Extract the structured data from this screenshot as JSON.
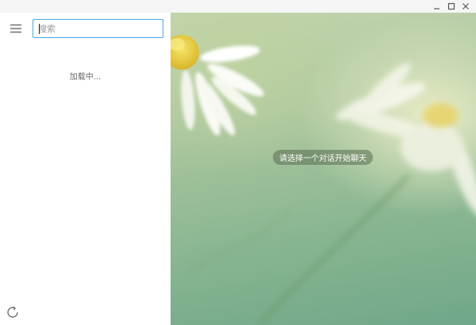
{
  "window": {
    "controls": {
      "minimize_icon": "minimize-icon",
      "maximize_icon": "maximize-icon",
      "close_icon": "close-icon"
    }
  },
  "sidebar": {
    "menu_icon": "hamburger-menu-icon",
    "search": {
      "placeholder": "搜索",
      "value": ""
    },
    "loading_text": "加载中...",
    "refresh_icon": "refresh-icon",
    "search_border_color": "#4aa8e0"
  },
  "chat": {
    "empty_hint": "请选择一个对话开始聊天"
  }
}
